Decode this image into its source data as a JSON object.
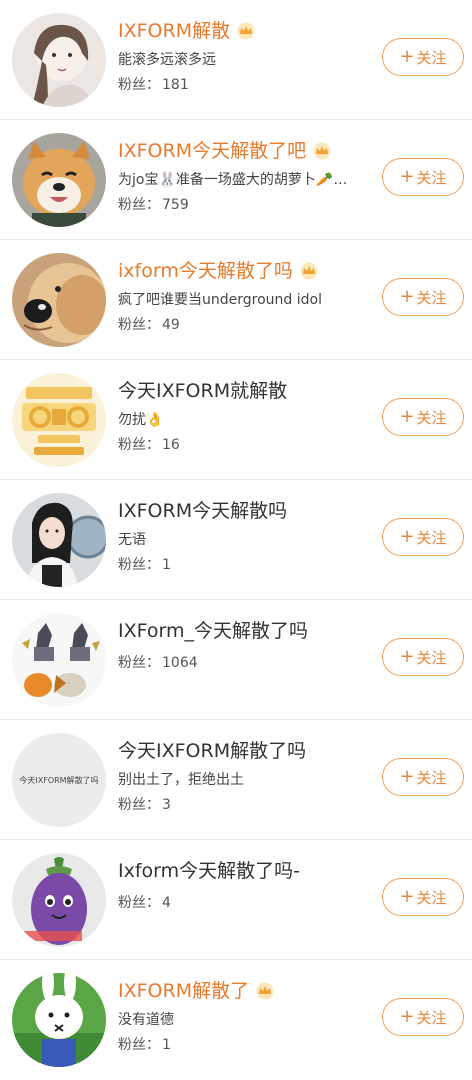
{
  "users": [
    {
      "name": "IXFORM解散",
      "vip": true,
      "desc": "能滚多远滚多远",
      "fans_label": "粉丝：",
      "fans": "181",
      "follow": "关注",
      "avatar": "avatar-girl-sketch"
    },
    {
      "name": "IXFORM今天解散了吧",
      "vip": true,
      "desc": "为jo宝🐰准备一场盛大的胡萝卜🥕…",
      "fans_label": "粉丝：",
      "fans": "759",
      "follow": "关注",
      "avatar": "avatar-shiba-dog"
    },
    {
      "name": "ixform今天解散了吗",
      "vip": true,
      "desc": "疯了吧谁要当underground idol",
      "fans_label": "粉丝：",
      "fans": "49",
      "follow": "关注",
      "avatar": "avatar-golden-retriever"
    },
    {
      "name": "今天IXFORM就解散",
      "vip": false,
      "desc": "勿扰👌",
      "fans_label": "粉丝：",
      "fans": "16",
      "follow": "关注",
      "avatar": "avatar-poster-text"
    },
    {
      "name": "IXFORM今天解散吗",
      "vip": false,
      "desc": "无语",
      "fans_label": "粉丝：",
      "fans": "1",
      "follow": "关注",
      "avatar": "avatar-girl-photo"
    },
    {
      "name": "IXForm_今天解散了吗",
      "vip": false,
      "desc": "",
      "fans_label": "粉丝：",
      "fans": "1064",
      "follow": "关注",
      "avatar": "avatar-game-characters"
    },
    {
      "name": "今天IXFORM解散了吗",
      "vip": false,
      "desc": "别出土了，拒绝出土",
      "fans_label": "粉丝：",
      "fans": "3",
      "follow": "关注",
      "avatar": "avatar-text-circle",
      "avatar_text": "今天IXFORM解散了吗"
    },
    {
      "name": "Ixform今天解散了吗-",
      "vip": false,
      "desc": "",
      "fans_label": "粉丝：",
      "fans": "4",
      "follow": "关注",
      "avatar": "avatar-eggplant-plush"
    },
    {
      "name": "IXFORM解散了",
      "vip": true,
      "desc": "没有道德",
      "fans_label": "粉丝：",
      "fans": "1",
      "follow": "关注",
      "avatar": "avatar-bunny"
    }
  ],
  "colors": {
    "vip_name": "#e87a2a",
    "follow_border": "#f0a35a",
    "follow_text": "#e8883a"
  }
}
